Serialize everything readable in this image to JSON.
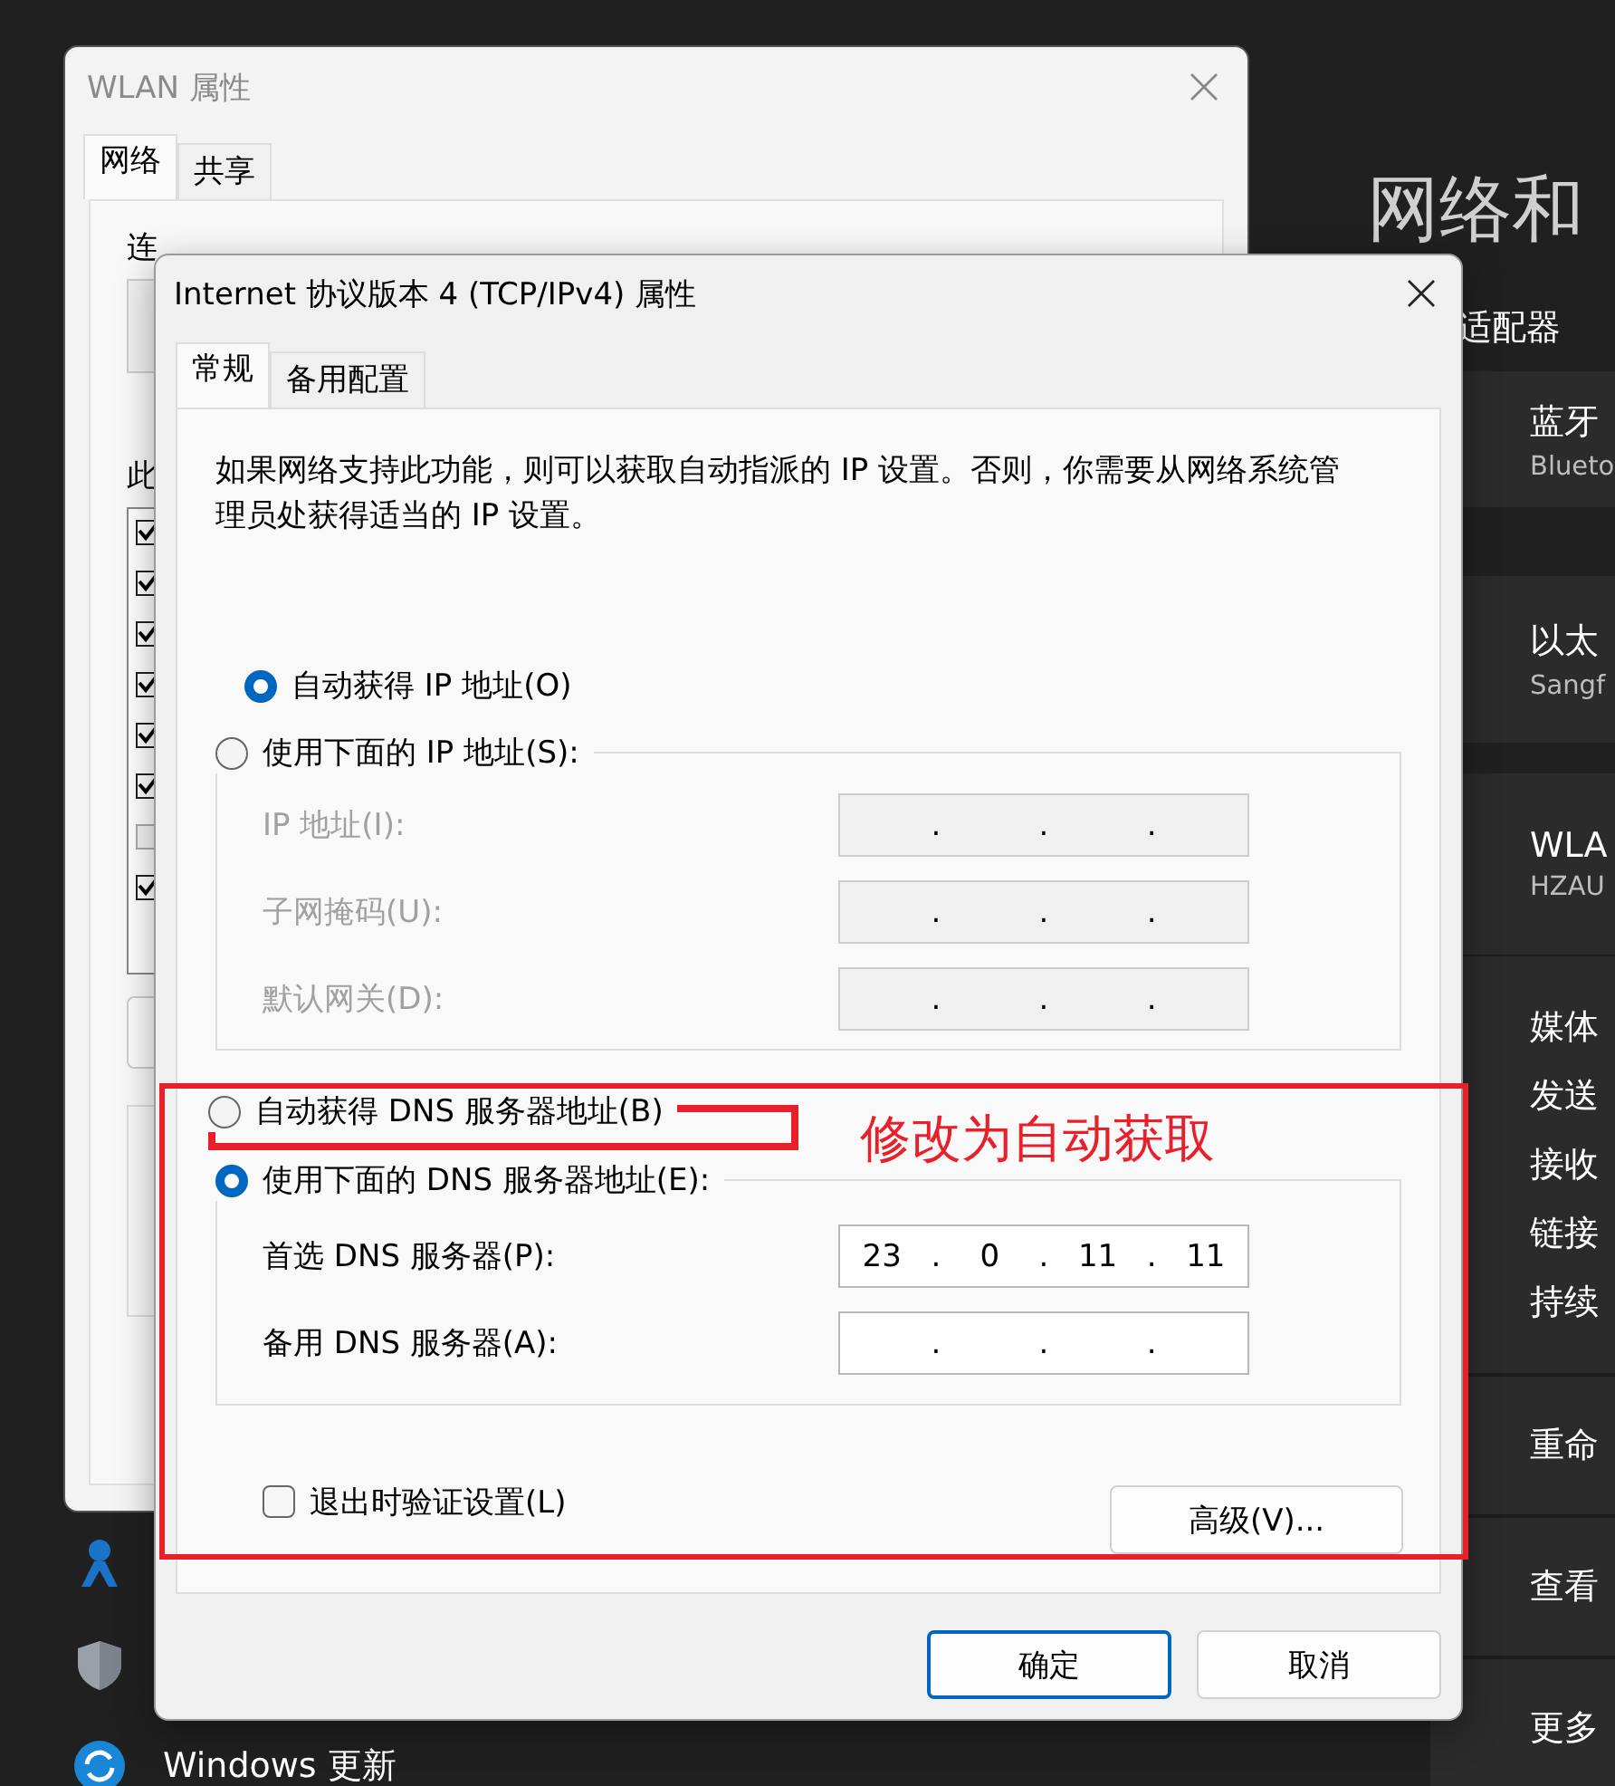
{
  "settings": {
    "title": "网络和",
    "section": "适配器",
    "adapters": [
      {
        "name": "蓝牙",
        "detail": "Blueto"
      },
      {
        "name": "以太",
        "detail": "Sangf"
      },
      {
        "name": "WLA",
        "detail": "HZAU"
      }
    ],
    "properties": [
      "媒体",
      "发送",
      "接收",
      "链接",
      "持续"
    ],
    "actions": [
      "重命",
      "查看",
      "更多"
    ]
  },
  "sidebar": {
    "items": [
      {
        "kind": "person"
      },
      {
        "kind": "shield"
      },
      {
        "kind": "update",
        "label": "Windows 更新"
      }
    ]
  },
  "wlan_window": {
    "title": "WLAN 属性",
    "tabs": [
      {
        "label": "网络",
        "selected": true
      },
      {
        "label": "共享",
        "selected": false
      }
    ],
    "labels": [
      "连",
      "此"
    ],
    "components": [
      {
        "checked": true
      },
      {
        "checked": true
      },
      {
        "checked": true
      },
      {
        "checked": true
      },
      {
        "checked": true
      },
      {
        "checked": true
      },
      {
        "checked": false
      },
      {
        "checked": true
      }
    ]
  },
  "ipv4_dialog": {
    "title": "Internet 协议版本 4 (TCP/IPv4) 属性",
    "tabs": [
      {
        "label": "常规",
        "selected": true
      },
      {
        "label": "备用配置",
        "selected": false
      }
    ],
    "description": "如果网络支持此功能，则可以获取自动指派的 IP 设置。否则，你需要从网络系统管理员处获得适当的 IP 设置。",
    "ip_options": [
      {
        "label": "自动获得 IP 地址(O)",
        "selected": true
      },
      {
        "label": "使用下面的 IP 地址(S):",
        "selected": false
      }
    ],
    "ip_group": {
      "disabled": true,
      "fields": [
        {
          "label": "IP 地址(I):",
          "dots": [
            ".",
            ".",
            "."
          ]
        },
        {
          "label": "子网掩码(U):",
          "dots": [
            ".",
            ".",
            "."
          ]
        },
        {
          "label": "默认网关(D):",
          "dots": [
            ".",
            ".",
            "."
          ]
        }
      ]
    },
    "dns_options": [
      {
        "label": "自动获得 DNS 服务器地址(B)",
        "selected": false
      },
      {
        "label": "使用下面的 DNS 服务器地址(E):",
        "selected": true
      }
    ],
    "dns_group": {
      "disabled": false,
      "fields": [
        {
          "label": "首选 DNS 服务器(P):",
          "dots": [
            ".",
            ".",
            "."
          ],
          "octets": [
            "23",
            "0",
            "11",
            "11"
          ]
        },
        {
          "label": "备用 DNS 服务器(A):",
          "dots": [
            ".",
            ".",
            "."
          ]
        }
      ]
    },
    "validate": {
      "label": "退出时验证设置(L)",
      "checked": false
    },
    "advanced_button": "高级(V)...",
    "buttons": [
      {
        "label": "确定",
        "default": true
      },
      {
        "label": "取消",
        "default": false
      }
    ]
  },
  "annotation": {
    "note": "修改为自动获取"
  }
}
